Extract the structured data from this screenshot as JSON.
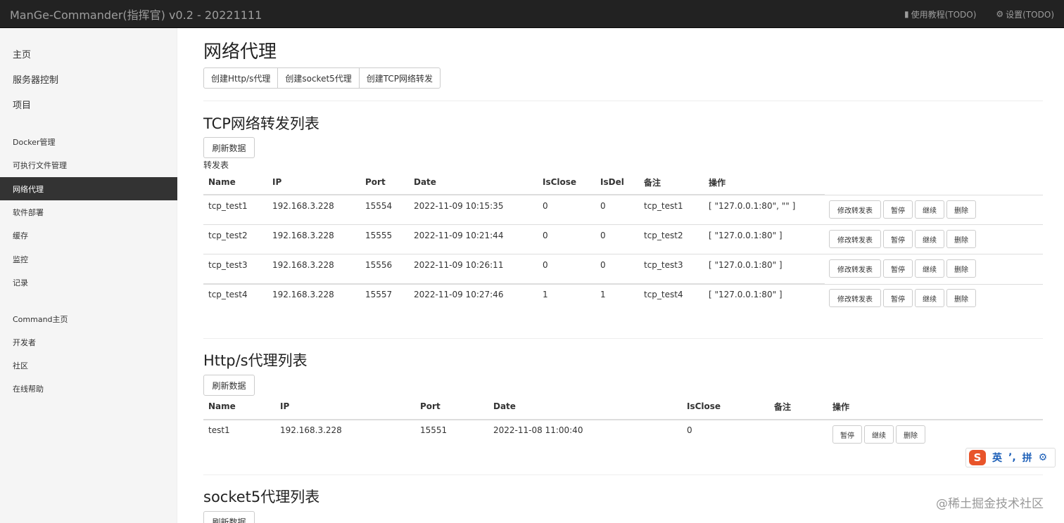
{
  "navbar": {
    "brand": "ManGe-Commander(指挥官) v0.2 - 20221111",
    "tutorial_label": "使用教程(TODO)",
    "settings_label": "设置(TODO)"
  },
  "sidebar": {
    "items": [
      "主页",
      "服务器控制",
      "项目",
      "Docker管理",
      "可执行文件管理",
      "网络代理",
      "软件部署",
      "缓存",
      "监控",
      "记录",
      "Command主页",
      "开发者",
      "社区",
      "在线帮助"
    ],
    "active": "网络代理"
  },
  "page": {
    "title": "网络代理",
    "actions": [
      "创建Http/s代理",
      "创建socket5代理",
      "创建TCP网络转发"
    ]
  },
  "tcp_section": {
    "title": "TCP网络转发列表",
    "refresh_label": "刷新数据",
    "caption": "转发表",
    "columns": [
      "Name",
      "IP",
      "Port",
      "Date",
      "IsClose",
      "IsDel",
      "备注",
      "操作"
    ],
    "rows": [
      {
        "name": "tcp_test1",
        "ip": "192.168.3.228",
        "port": "15554",
        "date": "2022-11-09 10:15:35",
        "isclose": "0",
        "isdel": "0",
        "note": "tcp_test1",
        "op": "[ \"127.0.0.1:80\", \"\" ]"
      },
      {
        "name": "tcp_test2",
        "ip": "192.168.3.228",
        "port": "15555",
        "date": "2022-11-09 10:21:44",
        "isclose": "0",
        "isdel": "0",
        "note": "tcp_test2",
        "op": "[ \"127.0.0.1:80\" ]"
      },
      {
        "name": "tcp_test3",
        "ip": "192.168.3.228",
        "port": "15556",
        "date": "2022-11-09 10:26:11",
        "isclose": "0",
        "isdel": "0",
        "note": "tcp_test3",
        "op": "[ \"127.0.0.1:80\" ]"
      },
      {
        "name": "tcp_test4",
        "ip": "192.168.3.228",
        "port": "15557",
        "date": "2022-11-09 10:27:46",
        "isclose": "1",
        "isdel": "1",
        "note": "tcp_test4",
        "op": "[ \"127.0.0.1:80\" ]"
      }
    ],
    "row_buttons": [
      "修改转发表",
      "暂停",
      "继续",
      "删除"
    ]
  },
  "http_section": {
    "title": "Http/s代理列表",
    "refresh_label": "刷新数据",
    "columns": [
      "Name",
      "IP",
      "Port",
      "Date",
      "IsClose",
      "备注",
      "操作"
    ],
    "rows": [
      {
        "name": "test1",
        "ip": "192.168.3.228",
        "port": "15551",
        "date": "2022-11-08 11:00:40",
        "isclose": "0",
        "note": ""
      }
    ],
    "row_buttons": [
      "暂停",
      "继续",
      "删除"
    ]
  },
  "socket5_section": {
    "title": "socket5代理列表",
    "refresh_label": "刷新数据"
  },
  "ime": {
    "mode": "英",
    "pinyin": "拼"
  },
  "watermark": "@稀土掘金技术社区"
}
